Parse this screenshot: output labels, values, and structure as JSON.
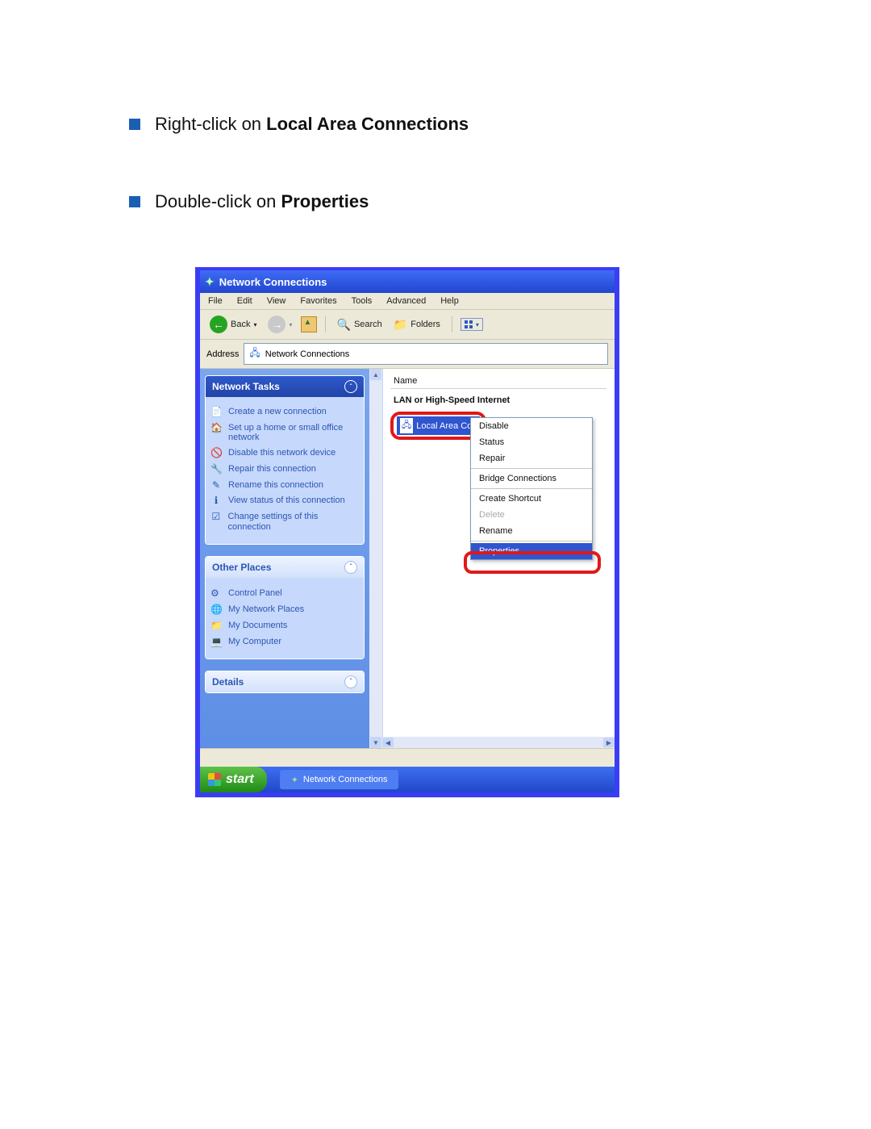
{
  "instructions": [
    {
      "pre": "Right-click on ",
      "bold": "Local Area Connections"
    },
    {
      "pre": "Double-click on ",
      "bold": "Properties"
    }
  ],
  "window": {
    "title": "Network Connections",
    "menu": [
      "File",
      "Edit",
      "View",
      "Favorites",
      "Tools",
      "Advanced",
      "Help"
    ],
    "toolbar": {
      "back": "Back",
      "search": "Search",
      "folders": "Folders"
    },
    "address": {
      "label": "Address",
      "value": "Network Connections"
    },
    "sidebar": {
      "tasks_title": "Network Tasks",
      "tasks": [
        "Create a new connection",
        "Set up a home or small office network",
        "Disable this network device",
        "Repair this connection",
        "Rename this connection",
        "View status of this connection",
        "Change settings of this connection"
      ],
      "places_title": "Other Places",
      "places": [
        "Control Panel",
        "My Network Places",
        "My Documents",
        "My Computer"
      ],
      "details_title": "Details"
    },
    "main": {
      "column": "Name",
      "group": "LAN or High-Speed Internet",
      "item": "Local Area Con"
    },
    "context_menu": {
      "items": [
        {
          "label": "Disable",
          "disabled": false
        },
        {
          "label": "Status",
          "disabled": false
        },
        {
          "label": "Repair",
          "disabled": false
        },
        {
          "sep": true
        },
        {
          "label": "Bridge Connections",
          "disabled": false
        },
        {
          "sep": true
        },
        {
          "label": "Create Shortcut",
          "disabled": false
        },
        {
          "label": "Delete",
          "disabled": true
        },
        {
          "label": "Rename",
          "disabled": false
        },
        {
          "sep": true
        },
        {
          "label": "Properties",
          "selected": true
        }
      ]
    },
    "taskbar": {
      "start": "start",
      "app": "Network Connections"
    }
  }
}
